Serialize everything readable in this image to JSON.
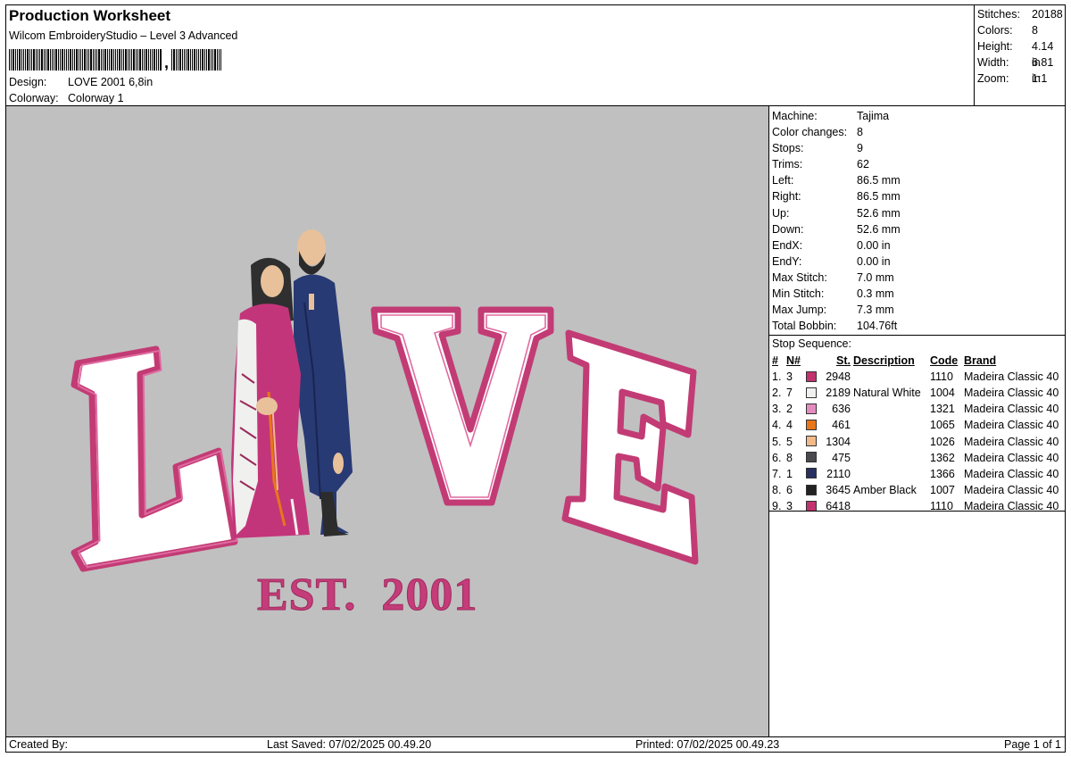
{
  "header": {
    "title": "Production Worksheet",
    "software": "Wilcom EmbroideryStudio – Level 3 Advanced",
    "design_label": "Design:",
    "design_value": "LOVE 2001 6,8in",
    "colorway_label": "Colorway:",
    "colorway_value": "Colorway 1"
  },
  "stats": [
    {
      "label": "Stitches:",
      "value": "20188"
    },
    {
      "label": "Colors:",
      "value": "8"
    },
    {
      "label": "Height:",
      "value": "4.14 in"
    },
    {
      "label": "Width:",
      "value": "6.81 in"
    },
    {
      "label": "Zoom:",
      "value": "1:1"
    }
  ],
  "machine_info": [
    {
      "label": "Machine:",
      "value": "Tajima"
    },
    {
      "label": "Color changes:",
      "value": "8"
    },
    {
      "label": "Stops:",
      "value": "9"
    },
    {
      "label": "Trims:",
      "value": "62"
    },
    {
      "label": "Left:",
      "value": "86.5 mm"
    },
    {
      "label": "Right:",
      "value": "86.5 mm"
    },
    {
      "label": "Up:",
      "value": "52.6 mm"
    },
    {
      "label": "Down:",
      "value": "52.6 mm"
    },
    {
      "label": "EndX:",
      "value": "0.00 in"
    },
    {
      "label": "EndY:",
      "value": "0.00 in"
    },
    {
      "label": "Max Stitch:",
      "value": "7.0 mm"
    },
    {
      "label": "Min Stitch:",
      "value": "0.3 mm"
    },
    {
      "label": "Max Jump:",
      "value": "7.3 mm"
    },
    {
      "label": "Total Bobbin:",
      "value": "104.76ft"
    }
  ],
  "stop_sequence": {
    "title": "Stop Sequence:",
    "columns": [
      "#",
      "N#",
      "St.",
      "Description",
      "Code",
      "Brand"
    ],
    "rows": [
      {
        "num": "1.",
        "n": "3",
        "color": "#c0336e",
        "st": "2948",
        "desc": "",
        "code": "1110",
        "brand": "Madeira Classic 40"
      },
      {
        "num": "2.",
        "n": "7",
        "color": "#f0f0ee",
        "st": "2189",
        "desc": "Natural White",
        "code": "1004",
        "brand": "Madeira Classic 40"
      },
      {
        "num": "3.",
        "n": "2",
        "color": "#e48cc0",
        "st": "636",
        "desc": "",
        "code": "1321",
        "brand": "Madeira Classic 40"
      },
      {
        "num": "4.",
        "n": "4",
        "color": "#e8761a",
        "st": "461",
        "desc": "",
        "code": "1065",
        "brand": "Madeira Classic 40"
      },
      {
        "num": "5.",
        "n": "5",
        "color": "#f2b98a",
        "st": "1304",
        "desc": "",
        "code": "1026",
        "brand": "Madeira Classic 40"
      },
      {
        "num": "6.",
        "n": "8",
        "color": "#4a4a4e",
        "st": "475",
        "desc": "",
        "code": "1362",
        "brand": "Madeira Classic 40"
      },
      {
        "num": "7.",
        "n": "1",
        "color": "#283060",
        "st": "2110",
        "desc": "",
        "code": "1366",
        "brand": "Madeira Classic 40"
      },
      {
        "num": "8.",
        "n": "6",
        "color": "#222222",
        "st": "3645",
        "desc": "Amber Black",
        "code": "1007",
        "brand": "Madeira Classic 40"
      },
      {
        "num": "9.",
        "n": "3",
        "color": "#c0336e",
        "st": "6418",
        "desc": "",
        "code": "1110",
        "brand": "Madeira Classic 40"
      }
    ]
  },
  "design_preview": {
    "letters": [
      "L",
      "V",
      "E"
    ],
    "subtitle": "EST.  2001",
    "background_color": "#c0c0c0",
    "outline_color": "#c23b74",
    "fill_color": "#ffffff"
  },
  "footer": {
    "created_by": "Created By:",
    "last_saved": "Last Saved: 07/02/2025 00.49.20",
    "printed": "Printed: 07/02/2025 00.49.23",
    "page": "Page 1 of 1"
  }
}
